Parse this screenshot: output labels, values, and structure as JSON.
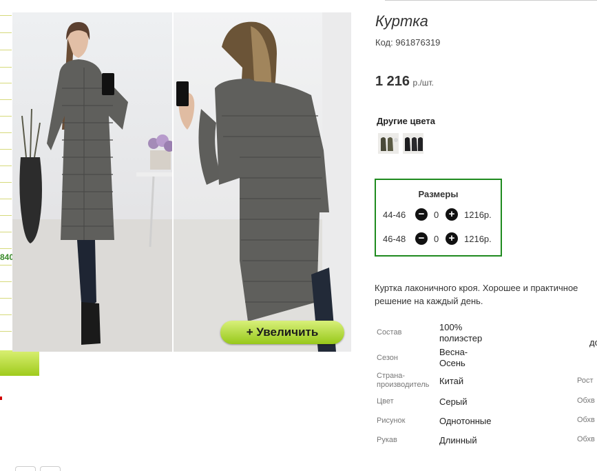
{
  "left_column": {
    "price_fragment": "840"
  },
  "product": {
    "title": "Куртка",
    "code_label": "Код:",
    "code": "961876319",
    "price": "1 216",
    "price_unit": "р./шт."
  },
  "gallery": {
    "zoom_label": "+  Увеличить"
  },
  "other_colors": {
    "heading": "Другие цвета"
  },
  "sizes": {
    "title": "Размеры",
    "rows": [
      {
        "size": "44-46",
        "qty": "0",
        "price": "1216р."
      },
      {
        "size": "46-48",
        "qty": "0",
        "price": "1216р."
      }
    ],
    "minus_symbol": "−",
    "plus_symbol": "+"
  },
  "description": "Куртка лаконичного кроя. Хорошее и практичное решение на каждый день.",
  "properties": [
    {
      "label": "Состав",
      "value": "100% полиэстер"
    },
    {
      "label": "Сезон",
      "value": "Весна-Осень"
    },
    {
      "label": "Страна-производитель",
      "value": "Китай"
    },
    {
      "label": "Цвет",
      "value": "Серый"
    },
    {
      "label": "Рисунок",
      "value": "Однотонные"
    },
    {
      "label": "Рукав",
      "value": "Длинный"
    }
  ],
  "right_column_fragments": [
    "до",
    "Рост",
    "Обхв",
    "Обхв",
    "Обхв"
  ],
  "colors": {
    "accent_green": "#1e8a1e",
    "button_green": "#a8d42a"
  }
}
